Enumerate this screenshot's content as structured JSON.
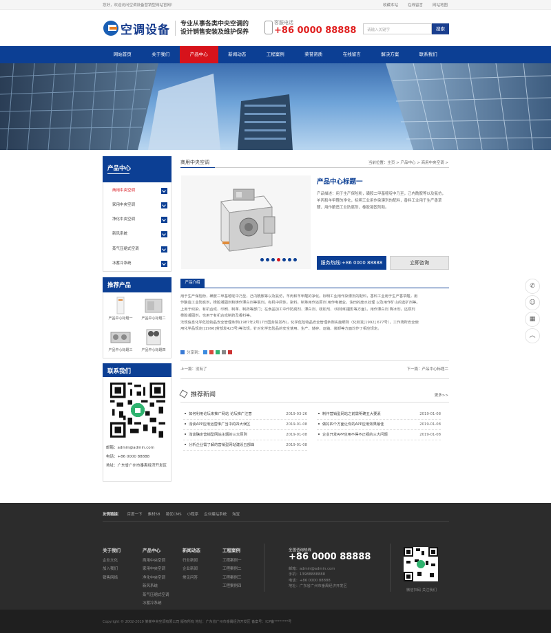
{
  "topbar": {
    "welcome": "您好，欢迎访问空调设备营销型网站官网！",
    "links": [
      "收藏本站",
      "在线留言",
      "网站地图"
    ]
  },
  "header": {
    "logo_text": "空调设备",
    "slogan_line1": "专业从事各类中央空调的",
    "slogan_line2": "设计销售安装及维护保养",
    "hotline_label": "客服电话",
    "hotline_number": "+86 0000 88888",
    "search_placeholder": "请输入关键字",
    "search_button": "搜索"
  },
  "nav": {
    "items": [
      "网站首页",
      "关于我们",
      "产品中心",
      "新闻动态",
      "工程案例",
      "荣誉资质",
      "在线留言",
      "解决方案",
      "联系我们"
    ],
    "active_index": 2
  },
  "sidebar": {
    "title": "产品中心",
    "categories": [
      "商用中央空调",
      "家用中央空调",
      "净化中央空调",
      "新风系统",
      "蒸气压缩式空调",
      "冰蓄冷系统"
    ],
    "active_index": 0,
    "recommend_title": "推荐产品",
    "recommend_items": [
      "产品中心标题一",
      "产品中心标题二",
      "产品中心标题三",
      "产品中心标题四"
    ],
    "contact_title": "联系我们",
    "contact_email": "邮箱：admin@admin.com",
    "contact_phone": "电话：+86 0000 88888",
    "contact_address": "地址：广东省广州市番禺经济开发区"
  },
  "main": {
    "section_title": "商用中央空调",
    "breadcrumb": "当前位置：主页 > 产品中心 > 商用中央空调 >",
    "product_name": "产品中心标题一",
    "product_desc": "产品描述：用于生产保险粉，磺胺二甲基嘧啶中乃至，己内酰胺等以及氨仿，羊丙和羊甲醛的净化，标明工业用作染漂剂的配料，香料工业用于生产香草醛，用作酿造工业防腐剂，橡胶凝固剂和。",
    "hotline_button": "服务热线:+86 0000 88888",
    "consult_button": "立即咨询",
    "tab_label": "产品介绍",
    "intro_lines": [
      "用于生产保险粉，磺胺二甲基嘧啶中乃至，己内酰胺等以及氨仿，羊丙和羊甲醛的净化。标明工业用作染漂剂的配料，香料工业用于生产香草醛，用",
      "作酿造工业防腐剂，橡胶凝固剂和铸作漂白剂等氯剂。有机中间体，染料，制革用作还原剂 用作电镀业，油田的废水处理 以及用作矿山的选矿剂等。",
      "上用于织染、有机合成、印刷、制革、制药等部门；在食品加工中作防腐剂、漂白剂、疏松剂、（织物和撞影等方面）。用作漂白剂 降冰剂，还原剂",
      "橡胶凝固剂，也用于有机合成制药及香料等。",
      "法规信息化学危险物品安全管理条例(1987年2月17日国务院发布)，化学危险物品安全管理条例实施细则（化劳发[1992] 677号），工作场所安全使",
      "用化学品规定([1996]劳部发423号)等法规，针对化学危险品的安全使用、生产、储存、运输、装卸等方面均作了相应规定。"
    ],
    "share_label": "分享到：",
    "prev": "上一篇：没有了",
    "next": "下一篇：产品中心标题二",
    "news_title": "推荐新闻",
    "news_more": "更多>>",
    "news_left": [
      {
        "title": "如何利用论坛来推广网站 论坛推广注意",
        "date": "2019-03-26"
      },
      {
        "title": "浅谈APP应用运营推广当中的四大误区",
        "date": "2019-01-08"
      },
      {
        "title": "浅谈确定营销型网站主题的三大原则",
        "date": "2019-01-08"
      },
      {
        "title": "分析企业需了解的营销型网站建设五部曲",
        "date": "2019-01-08"
      }
    ],
    "news_right": [
      {
        "title": "制作营销型网站之前需明确五大要素",
        "date": "2019-01-08"
      },
      {
        "title": "做好四个方面让你的APP应用效果最佳",
        "date": "2019-01-08"
      },
      {
        "title": "企业开发APP应用不得不正视的三大问题",
        "date": "2019-01-08"
      }
    ]
  },
  "float_icons": [
    "phone-icon",
    "chat-icon",
    "qrcode-icon",
    "back-to-top-icon"
  ],
  "footer": {
    "friend_label": "友情链接：",
    "friend_links": [
      "百度一下",
      "素材58",
      "易优CMS",
      "小程序",
      "企业建站系统",
      "淘宝"
    ],
    "columns": [
      {
        "title": "关于我们",
        "items": [
          "企业文化",
          "加入我们",
          "销售网络"
        ]
      },
      {
        "title": "产品中心",
        "items": [
          "商用中央空调",
          "家用中央空调",
          "净化中央空调",
          "新风系统",
          "蒸气压缩式空调",
          "冰蓄冷系统"
        ]
      },
      {
        "title": "新闻动态",
        "items": [
          "行业新闻",
          "企业新闻",
          "常见问答"
        ]
      },
      {
        "title": "工程案例",
        "items": [
          "工程案例一",
          "工程案例二",
          "工程案例三",
          "工程案例四"
        ]
      }
    ],
    "hotline_label": "全国咨询热线",
    "hotline": "+86 0000 88888",
    "info_lines": [
      "邮箱：admin@admin.com",
      "手机：13988888888",
      "电话：+86 0000 88888",
      "地址：广东省广州市番禺经济开发区"
    ],
    "qr_caption": "微信扫码 关注我们",
    "copyright": "Copyright © 2002-2019 某某中央空调有限公司 版权所有   地址：广东省广州市番禺经济开发区   备案号：ICP备********号"
  },
  "colors": {
    "brand_blue": "#0c3f94",
    "accent_red": "#d7131b",
    "footer_bg": "#2c2c2c"
  }
}
